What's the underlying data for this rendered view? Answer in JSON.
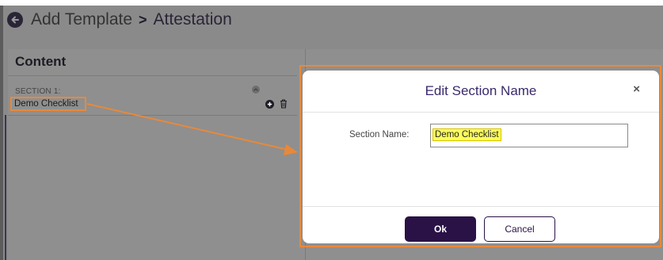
{
  "header": {
    "back_icon": "arrow-left-circle-icon",
    "crumb_parent": "Add Template",
    "separator": ">",
    "crumb_current": "Attestation"
  },
  "content": {
    "title": "Content",
    "section_label": "SECTION 1:",
    "item_name": "Demo Checklist",
    "collapse_icon": "chevron-up-circle-icon",
    "add_icon": "plus-circle-icon",
    "delete_icon": "trash-icon"
  },
  "modal": {
    "title": "Edit Section Name",
    "close_label": "×",
    "field_label": "Section Name:",
    "field_value": "Demo Checklist",
    "ok_label": "Ok",
    "cancel_label": "Cancel"
  },
  "colors": {
    "annotation": "#e8893a",
    "primary": "#2a1246",
    "highlight": "#ffff5a"
  }
}
